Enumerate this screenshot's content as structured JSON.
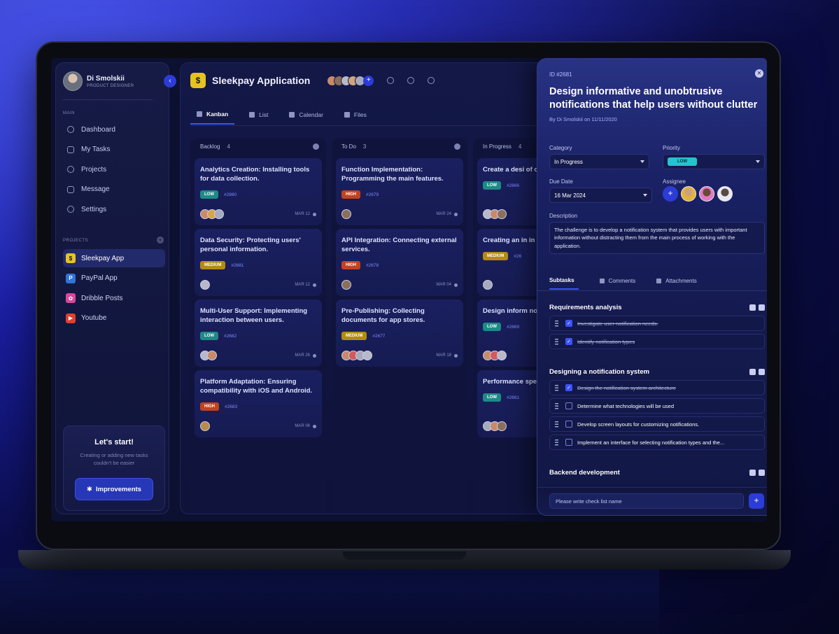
{
  "colors": {
    "accent": "#3d52ff",
    "low": "#1e8a86",
    "high": "#c2421e",
    "medium": "#b48b12",
    "brand_yellow": "#e5c321"
  },
  "user": {
    "name": "Di Smolskii",
    "role": "PRODUCT DESIGNER"
  },
  "sidebar": {
    "main_label": "MAIN",
    "nav": [
      {
        "label": "Dashboard",
        "icon": "home-icon"
      },
      {
        "label": "My Tasks",
        "icon": "tasks-icon"
      },
      {
        "label": "Projects",
        "icon": "projects-icon"
      },
      {
        "label": "Message",
        "icon": "message-icon"
      },
      {
        "label": "Settings",
        "icon": "gear-icon"
      }
    ],
    "projects_label": "PROJECTS",
    "projects": [
      {
        "label": "Sleekpay App",
        "icon": "$",
        "color": "#e5c321"
      },
      {
        "label": "PayPal App",
        "icon": "P",
        "color": "#2f74d8"
      },
      {
        "label": "Dribble Posts",
        "icon": "✿",
        "color": "#d9479a"
      },
      {
        "label": "Youtube",
        "icon": "▶",
        "color": "#e0402c"
      }
    ],
    "promo": {
      "title": "Let's start!",
      "text": "Creating or adding new tasks couldn't be easier",
      "button": "Improvements"
    }
  },
  "header": {
    "logo": "$",
    "title": "Sleekpay Application"
  },
  "tabs": [
    "Kanban",
    "List",
    "Calendar",
    "Files"
  ],
  "columns": [
    {
      "name": "Backlog",
      "count": "4",
      "cards": [
        {
          "title": "Analytics Creation: Installing tools for data collection.",
          "priority": "LOW",
          "id": "#2880",
          "date": "MAR 12"
        },
        {
          "title": "Data Security: Protecting users' personal information.",
          "priority": "MEDIUM",
          "id": "#2681",
          "date": "MAR 12"
        },
        {
          "title": "Multi-User Support: Implementing interaction between users.",
          "priority": "LOW",
          "id": "#2682",
          "date": "MAR 26"
        },
        {
          "title": "Platform Adaptation: Ensuring compatibility with iOS and Android.",
          "priority": "HIGH",
          "id": "#2683",
          "date": "MAR 06"
        }
      ]
    },
    {
      "name": "To Do",
      "count": "3",
      "cards": [
        {
          "title": "Function Implementation: Programming the main features.",
          "priority": "HIGH",
          "id": "#2679",
          "date": "MAR 24"
        },
        {
          "title": "API Integration: Connecting external services.",
          "priority": "HIGH",
          "id": "#2678",
          "date": "MAR 04"
        },
        {
          "title": "Pre-Publishing: Collecting documents for app stores.",
          "priority": "MEDIUM",
          "id": "#2677",
          "date": "MAR 18"
        }
      ]
    },
    {
      "name": "In Progress",
      "count": "4",
      "cards": [
        {
          "title": "Create a desi of colors, for",
          "priority": "LOW",
          "id": "#2666",
          "date": ""
        },
        {
          "title": "Creating an in in Figma proc",
          "priority": "MEDIUM",
          "id": "#26",
          "date": ""
        },
        {
          "title": "Design inform notifications",
          "priority": "LOW",
          "id": "#2669",
          "date": ""
        },
        {
          "title": "Performance speed and sm",
          "priority": "LOW",
          "id": "#2661",
          "date": ""
        }
      ]
    }
  ],
  "detail": {
    "id": "ID #2681",
    "title": "Design informative and unobtrusive notifications that help users without clutter",
    "by": "By Di Smolskii on 11/11/2020",
    "category_label": "Category",
    "category": "In Progress",
    "priority_label": "Priority",
    "priority": "LOW",
    "due_label": "Due Date",
    "due": "16 Mar 2024",
    "assignee_label": "Assignee",
    "description_label": "Description",
    "description": "The challenge is to develop a notification system that provides users with important information without distracting them from the main process of working with the application.",
    "tabs": [
      "Subtasks",
      "Comments",
      "Attachments"
    ],
    "groups": [
      {
        "title": "Requirements analysis",
        "tasks": [
          {
            "text": "Investigate user notification needs.",
            "done": true
          },
          {
            "text": "Identify notification types",
            "done": true
          }
        ]
      },
      {
        "title": "Designing a notification system",
        "tasks": [
          {
            "text": "Design the notification system architecture",
            "done": true
          },
          {
            "text": "Determine what technologies will be used",
            "done": false
          },
          {
            "text": "Develop screen layouts for customizing notifications.",
            "done": false
          },
          {
            "text": "Implement an interface for selecting notification types and the...",
            "done": false
          }
        ]
      },
      {
        "title": "Backend development",
        "tasks": []
      }
    ],
    "composer_placeholder": "Please write check list name"
  }
}
